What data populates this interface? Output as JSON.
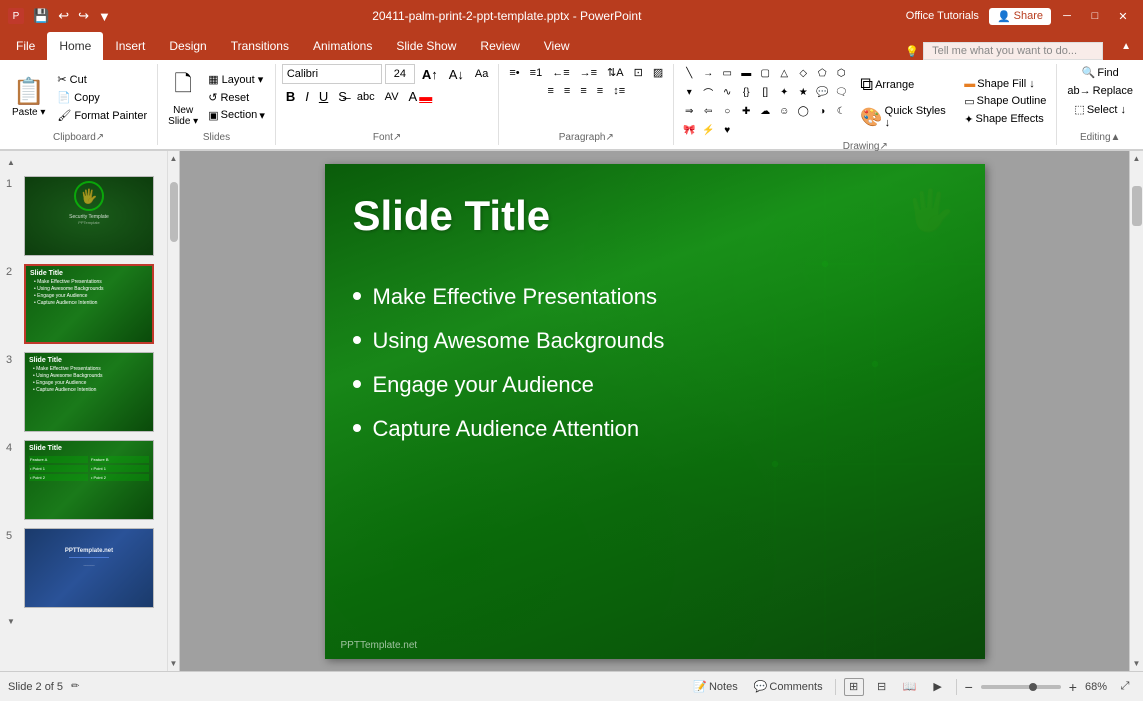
{
  "titleBar": {
    "filename": "20411-palm-print-2-ppt-template.pptx - PowerPoint",
    "windowControls": [
      "minimize",
      "maximize",
      "close"
    ]
  },
  "tabs": [
    {
      "id": "file",
      "label": "File"
    },
    {
      "id": "home",
      "label": "Home",
      "active": true
    },
    {
      "id": "insert",
      "label": "Insert"
    },
    {
      "id": "design",
      "label": "Design"
    },
    {
      "id": "transitions",
      "label": "Transitions"
    },
    {
      "id": "animations",
      "label": "Animations"
    },
    {
      "id": "slideshow",
      "label": "Slide Show"
    },
    {
      "id": "review",
      "label": "Review"
    },
    {
      "id": "view",
      "label": "View"
    }
  ],
  "ribbon": {
    "groups": [
      {
        "id": "clipboard",
        "label": "Clipboard",
        "buttons": [
          "Paste",
          "Cut",
          "Copy",
          "Format Painter"
        ]
      },
      {
        "id": "slides",
        "label": "Slides",
        "buttons": [
          "New Slide",
          "Layout",
          "Reset",
          "Section"
        ]
      },
      {
        "id": "font",
        "label": "Font",
        "fontName": "Calibri",
        "fontSize": "24",
        "buttons": [
          "Bold",
          "Italic",
          "Underline",
          "Strikethrough",
          "Shadow",
          "Clear"
        ]
      },
      {
        "id": "paragraph",
        "label": "Paragraph",
        "buttons": [
          "Bullets",
          "Numbering",
          "Decrease Indent",
          "Increase Indent",
          "Align Left",
          "Center",
          "Align Right",
          "Justify",
          "Columns"
        ]
      },
      {
        "id": "drawing",
        "label": "Drawing",
        "buttons": [
          "Arrange",
          "Quick Styles",
          "Shape Fill",
          "Shape Outline",
          "Shape Effects"
        ]
      },
      {
        "id": "editing",
        "label": "Editing",
        "buttons": [
          "Find",
          "Replace",
          "Select"
        ]
      }
    ],
    "shapeFill": "Shape Fill ↓",
    "shapeOutline": "Shape Outline",
    "shapeEffects": "Shape Effects",
    "quickStyles": "Quick Styles ↓",
    "arrange": "Arrange",
    "find": "Find",
    "replace": "Replace",
    "select": "Select ↓"
  },
  "helpBar": {
    "placeholder": "Tell me what you want to do..."
  },
  "officeTutorials": "Office Tutorials",
  "share": "Share",
  "slides": [
    {
      "num": 1,
      "type": "security",
      "title": "Security Template",
      "subtitle": "PPTemplate"
    },
    {
      "num": 2,
      "type": "bullets",
      "title": "Slide Title",
      "bullets": [
        "Make Effective Presentations",
        "Using Awesome Backgrounds",
        "Engage your Audience",
        "Capture Audience Attention"
      ],
      "selected": true
    },
    {
      "num": 3,
      "type": "bullets",
      "title": "Slide Title",
      "bullets": [
        "Make Effective Presentations",
        "Using Awesome Backgrounds",
        "Engage your Audience",
        "Capture Audience Attention"
      ]
    },
    {
      "num": 4,
      "type": "table",
      "title": "Slide Title"
    },
    {
      "num": 5,
      "type": "blue",
      "title": "PPTTemplate.net"
    }
  ],
  "mainSlide": {
    "title": "Slide Title",
    "bullets": [
      "Make Effective Presentations",
      "Using Awesome Backgrounds",
      "Engage your Audience",
      "Capture Audience Attention"
    ],
    "watermark": "PPTTemplate.net"
  },
  "statusBar": {
    "slideInfo": "Slide 2 of 5",
    "notesBtn": "Notes",
    "commentsBtn": "Comments",
    "zoom": "68%",
    "viewModes": [
      "normal",
      "slide-sorter",
      "reading",
      "slideshow"
    ]
  }
}
